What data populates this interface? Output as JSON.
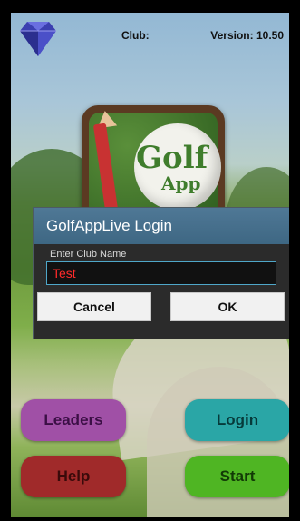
{
  "header": {
    "club_label": "Club:",
    "version_label": "Version: 10.50"
  },
  "logo": {
    "line1": "Golf",
    "line2": "App"
  },
  "dialog": {
    "title": "GolfAppLive Login",
    "field_label": "Enter Club Name",
    "field_value": "Test",
    "cancel_label": "Cancel",
    "ok_label": "OK"
  },
  "buttons": {
    "leaders": "Leaders",
    "login": "Login",
    "help": "Help",
    "start": "Start"
  },
  "colors": {
    "leaders": "#a050a6",
    "login": "#2aa6a6",
    "help": "#a02a2a",
    "start": "#4fb523",
    "dialog_title_bar": "#4f7896"
  }
}
